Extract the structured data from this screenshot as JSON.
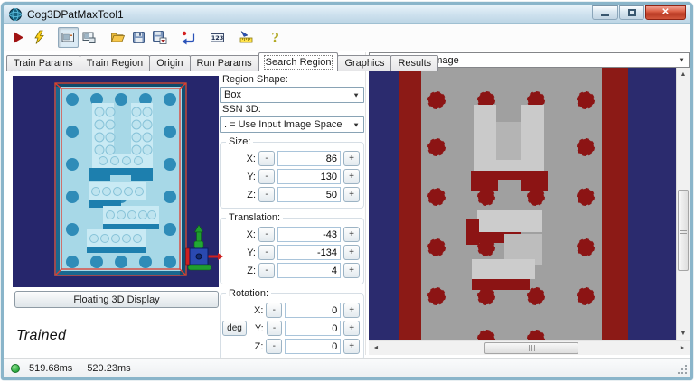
{
  "window": {
    "title": "Cog3DPatMaxTool1"
  },
  "ui": {
    "close_glyph": "✕",
    "dropdown_arrow": "▼",
    "scroll_up": "▲",
    "scroll_down": "▼",
    "scroll_left": "◄",
    "scroll_right": "►"
  },
  "toolbar": {
    "items": [
      {
        "name": "run-button"
      },
      {
        "name": "electric-run-button"
      },
      {
        "name": "show-current-record-toggle",
        "pressed": true
      },
      {
        "name": "show-lastrun-record-toggle",
        "pressed": false
      },
      {
        "name": "open-button"
      },
      {
        "name": "save-button"
      },
      {
        "name": "save-results-button"
      },
      {
        "name": "reset-button"
      },
      {
        "name": "results-numeric-button",
        "label": "123"
      },
      {
        "name": "calibration-button"
      },
      {
        "name": "help-button",
        "label": "?"
      }
    ]
  },
  "tabs": {
    "active_index": 4,
    "items": [
      {
        "label": "Train Params"
      },
      {
        "label": "Train Region"
      },
      {
        "label": "Origin"
      },
      {
        "label": "Run Params"
      },
      {
        "label": "Search Region"
      },
      {
        "label": "Graphics"
      },
      {
        "label": "Results"
      }
    ]
  },
  "left_panel": {
    "floating_display_button": "Floating 3D Display",
    "trained_status": "Trained"
  },
  "form": {
    "region_shape_label": "Region Shape:",
    "region_shape_value": "Box",
    "ssn3d_label": "SSN 3D:",
    "ssn3d_value": ". = Use Input Image Space",
    "minus": "-",
    "plus": "+",
    "deg_button": "deg",
    "size": {
      "label": "Size:",
      "x_label": "X:",
      "x": "86",
      "y_label": "Y:",
      "y": "130",
      "z_label": "Z:",
      "z": "50"
    },
    "translation": {
      "label": "Translation:",
      "x_label": "X:",
      "x": "-43",
      "y_label": "Y:",
      "y": "-134",
      "z_label": "Z:",
      "z": "4"
    },
    "rotation": {
      "label": "Rotation:",
      "x_label": "X:",
      "x": "0",
      "y_label": "Y:",
      "y": "0",
      "z_label": "Z:",
      "z": "0"
    }
  },
  "right_panel": {
    "selected_image": "Current.InputImage"
  },
  "statusbar": {
    "time1": "519.68ms",
    "time2": "520.23ms"
  },
  "colors": {
    "window_border": "#8ab5ca",
    "viewport_bg": "#26266c",
    "baseplate_cyan": "#a7d8e7",
    "stud_blue": "#2f8cb8",
    "wireframe_red": "#e23b2e",
    "image_gray": "#a0a0a0",
    "image_dark_red": "#8c1a16",
    "image_navy": "#2b2b6e",
    "status_green": "#2fae42"
  }
}
